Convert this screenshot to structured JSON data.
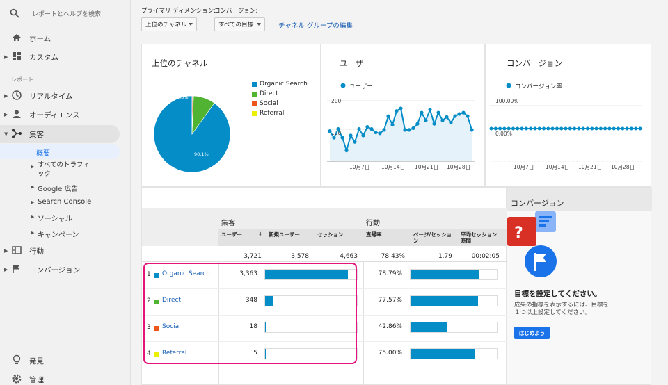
{
  "sidebar": {
    "search_placeholder": "レポートとヘルプを検索",
    "home": "ホーム",
    "custom": "カスタム",
    "section_reports": "レポート",
    "realtime": "リアルタイム",
    "audience": "オーディエンス",
    "acquisition": "集客",
    "acquisition_children": {
      "overview": "概要",
      "all_traffic": "すべてのトラフィック",
      "google_ads": "Google 広告",
      "search_console": "Search Console",
      "social": "ソーシャル",
      "campaigns": "キャンペーン"
    },
    "behavior": "行動",
    "conversions": "コンバージョン",
    "discover": "発見",
    "admin": "管理"
  },
  "toolbar": {
    "primary_dimension_label": "プライマリ ディメンション:",
    "conversion_label": "コンバージョン:",
    "primary_dimension_value": "上位のチャネル",
    "conversion_value": "すべての目標",
    "edit_channel_group": "チャネル グループの編集"
  },
  "top_channels": {
    "title": "上位のチャネル",
    "legend": [
      {
        "name": "Organic Search",
        "color": "#058dc7"
      },
      {
        "name": "Direct",
        "color": "#50b432"
      },
      {
        "name": "Social",
        "color": "#ed561b"
      },
      {
        "name": "Referral",
        "color": "#edef00"
      }
    ],
    "label_large": "90.1%",
    "label_small": "9.3%"
  },
  "users_chart": {
    "title": "ユーザー",
    "legend": "ユーザー",
    "y_ticks": [
      "200",
      "100"
    ],
    "x_ticks": [
      "10月7日",
      "10月14日",
      "10月21日",
      "10月28日"
    ]
  },
  "conv_chart": {
    "title": "コンバージョン",
    "legend": "コンバージョン率",
    "y_ticks": [
      "100.00%",
      "0.00%"
    ],
    "x_ticks": [
      "10月7日",
      "10月14日",
      "10月21日",
      "10月28日"
    ]
  },
  "chart_data": [
    {
      "type": "pie",
      "title": "上位のチャネル",
      "categories": [
        "Organic Search",
        "Direct",
        "Social",
        "Referral"
      ],
      "values": [
        90.1,
        9.3,
        0.5,
        0.1
      ]
    },
    {
      "type": "area",
      "title": "ユーザー",
      "series": [
        {
          "name": "ユーザー",
          "values": [
            125,
            110,
            130,
            110,
            80,
            115,
            100,
            130,
            115,
            135,
            130,
            122,
            120,
            128,
            160,
            140,
            172,
            178,
            128,
            128,
            132,
            142,
            168,
            150,
            175,
            142,
            168,
            150,
            158,
            145,
            160,
            165,
            168,
            160,
            128
          ]
        }
      ],
      "ylim": [
        55,
        220
      ]
    },
    {
      "type": "line",
      "title": "コンバージョン",
      "series": [
        {
          "name": "コンバージョン率",
          "values": [
            0,
            0,
            0,
            0,
            0,
            0,
            0,
            0,
            0,
            0,
            0,
            0,
            0,
            0,
            0,
            0,
            0,
            0,
            0,
            0,
            0,
            0,
            0,
            0,
            0,
            0,
            0,
            0,
            0,
            0,
            0,
            0,
            0,
            0,
            0
          ]
        }
      ],
      "ylim": [
        0,
        100
      ]
    }
  ],
  "table": {
    "group_acquisition": "集客",
    "group_behavior": "行動",
    "headers": [
      "ユーザー",
      "新規ユーザー",
      "セッション",
      "直帰率",
      "ページ/セッション",
      "平均セッション時間"
    ],
    "totals": [
      "3,721",
      "3,578",
      "4,663",
      "78.43%",
      "1.79",
      "00:02:05"
    ],
    "rows": [
      {
        "num": "1",
        "channel": "Organic Search",
        "color": "#058dc7",
        "users": "3,363",
        "users_share": 0.9,
        "bounce": "78.79%",
        "bounce_share": 0.79
      },
      {
        "num": "2",
        "channel": "Direct",
        "color": "#50b432",
        "users": "348",
        "users_share": 0.093,
        "bounce": "77.57%",
        "bounce_share": 0.78
      },
      {
        "num": "3",
        "channel": "Social",
        "color": "#ed561b",
        "users": "18",
        "users_share": 0.005,
        "bounce": "42.86%",
        "bounce_share": 0.43
      },
      {
        "num": "4",
        "channel": "Referral",
        "color": "#edef00",
        "users": "5",
        "users_share": 0.001,
        "bounce": "75.00%",
        "bounce_share": 0.75
      }
    ]
  },
  "conv_panel": {
    "title": "コンバージョン",
    "heading": "目標を設定してください。",
    "body": "成果の指標を表示するには、目標を１つ以上設定してください。",
    "button": "はじめよう"
  }
}
